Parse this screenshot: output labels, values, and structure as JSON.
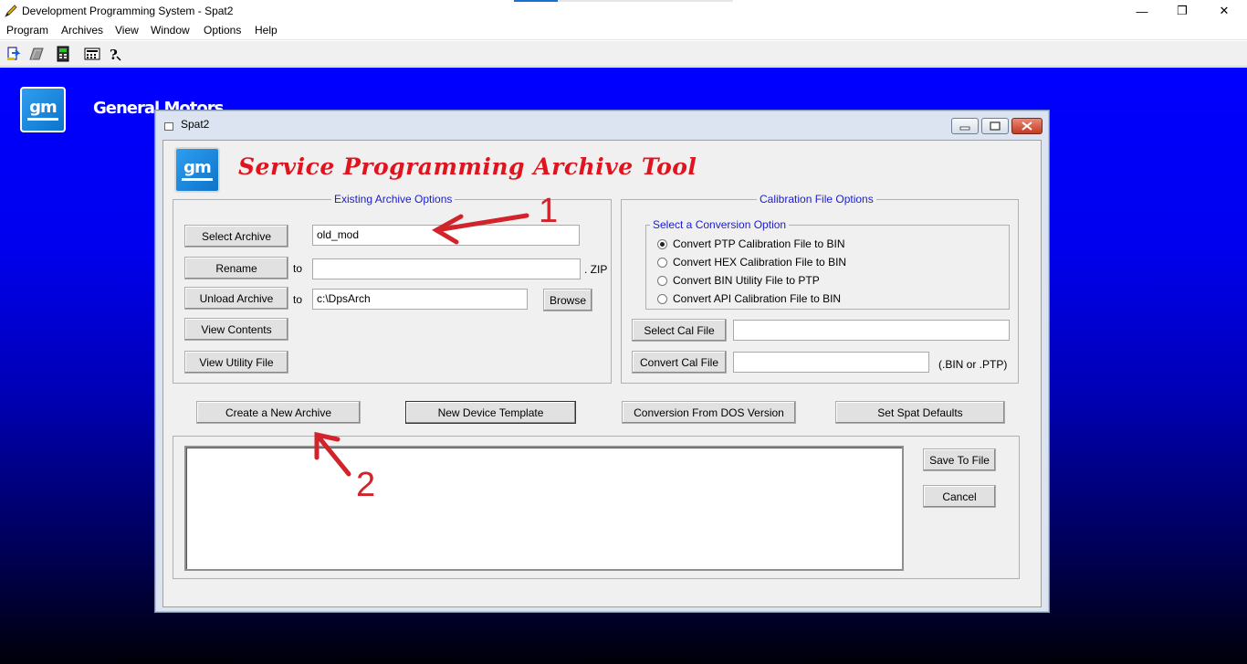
{
  "app": {
    "title": "Development Programming System - Spat2",
    "window_controls": {
      "minimize": "—",
      "restore": "❐",
      "close": "✕"
    }
  },
  "menu": [
    "Program",
    "Archives",
    "View",
    "Window",
    "Options",
    "Help"
  ],
  "toolbar_icons": [
    "program-icon",
    "archive-icon",
    "device-icon",
    "calculator-icon",
    "help-icon"
  ],
  "desktop": {
    "logo_text": "gm",
    "brand_text": "General  Motors"
  },
  "dialog": {
    "title": "Spat2",
    "logo_text": "gm",
    "banner": "Service Programming Archive Tool",
    "archive_options": {
      "legend": "Existing Archive Options",
      "select_archive_label": "Select Archive",
      "select_archive_value": "old_mod",
      "rename_label": "Rename",
      "rename_to": "to",
      "rename_value": "",
      "rename_suffix": ". ZIP",
      "unload_label": "Unload Archive",
      "unload_to": "to",
      "unload_value": "c:\\DpsArch",
      "browse_label": "Browse",
      "view_contents_label": "View Contents",
      "view_utility_label": "View Utility File"
    },
    "calibration": {
      "legend": "Calibration File Options",
      "conversion_legend": "Select a Conversion Option",
      "options": [
        {
          "label": "Convert PTP Calibration  File to BIN",
          "selected": true
        },
        {
          "label": "Convert HEX  Calibration  File to BIN",
          "selected": false
        },
        {
          "label": "Convert  BIN Utility  File to  PTP",
          "selected": false
        },
        {
          "label": "Convert API Calibration  File to BIN",
          "selected": false
        }
      ],
      "select_cal_label": "Select Cal File",
      "select_cal_value": "",
      "convert_cal_label": "Convert Cal File",
      "convert_cal_value": "",
      "convert_hint": "(.BIN or .PTP)"
    },
    "actions": {
      "create_archive": "Create a New Archive",
      "new_device_template": "New Device Template",
      "conversion_dos": "Conversion From DOS Version",
      "set_defaults": "Set Spat Defaults"
    },
    "log": {
      "content": "",
      "save_label": "Save To File",
      "cancel_label": "Cancel"
    }
  },
  "annotations": {
    "color": "#d2232a",
    "label_1": "1",
    "label_2": "2"
  }
}
